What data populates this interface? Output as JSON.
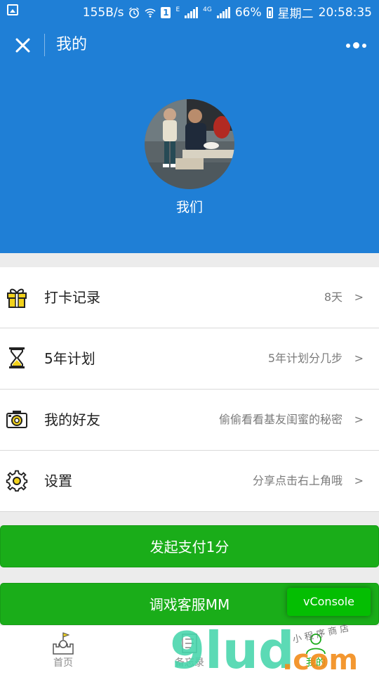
{
  "status_bar": {
    "network_speed": "155B/s",
    "sim_badge": "1",
    "network_e": "E",
    "network_4g": "4G",
    "battery_percent": "66%",
    "weekday": "星期二",
    "time": "20:58:35"
  },
  "title_bar": {
    "title": "我的"
  },
  "profile": {
    "nickname": "我们"
  },
  "menu": {
    "items": [
      {
        "label": "打卡记录",
        "detail": "8天",
        "arrow": ">",
        "icon": "gift-icon"
      },
      {
        "label": "5年计划",
        "detail": "5年计划分几步",
        "arrow": ">",
        "icon": "hourglass-icon"
      },
      {
        "label": "我的好友",
        "detail": "偷偷看看基友闺蜜的秘密",
        "arrow": ">",
        "icon": "camera-icon"
      },
      {
        "label": "设置",
        "detail": "分享点击右上角哦",
        "arrow": ">",
        "icon": "gear-icon"
      }
    ]
  },
  "buttons": {
    "pay": "发起支付1分",
    "service": "调戏客服MM"
  },
  "vconsole": {
    "label": "vConsole"
  },
  "tabbar": {
    "tabs": [
      {
        "label": "首页",
        "icon": "castle-flag-icon"
      },
      {
        "label": "备忘录",
        "icon": "memo-icon"
      },
      {
        "label": "我的",
        "icon": "profile-icon"
      }
    ]
  },
  "watermark": {
    "brand": "9lud",
    "domain": ".com",
    "tagline": "小 程 序 商 店"
  },
  "colors": {
    "header_blue": "#1f7fd6",
    "button_green": "#1aad19",
    "vconsole_green": "#04be02",
    "gift_yellow": "#f2d21b"
  }
}
